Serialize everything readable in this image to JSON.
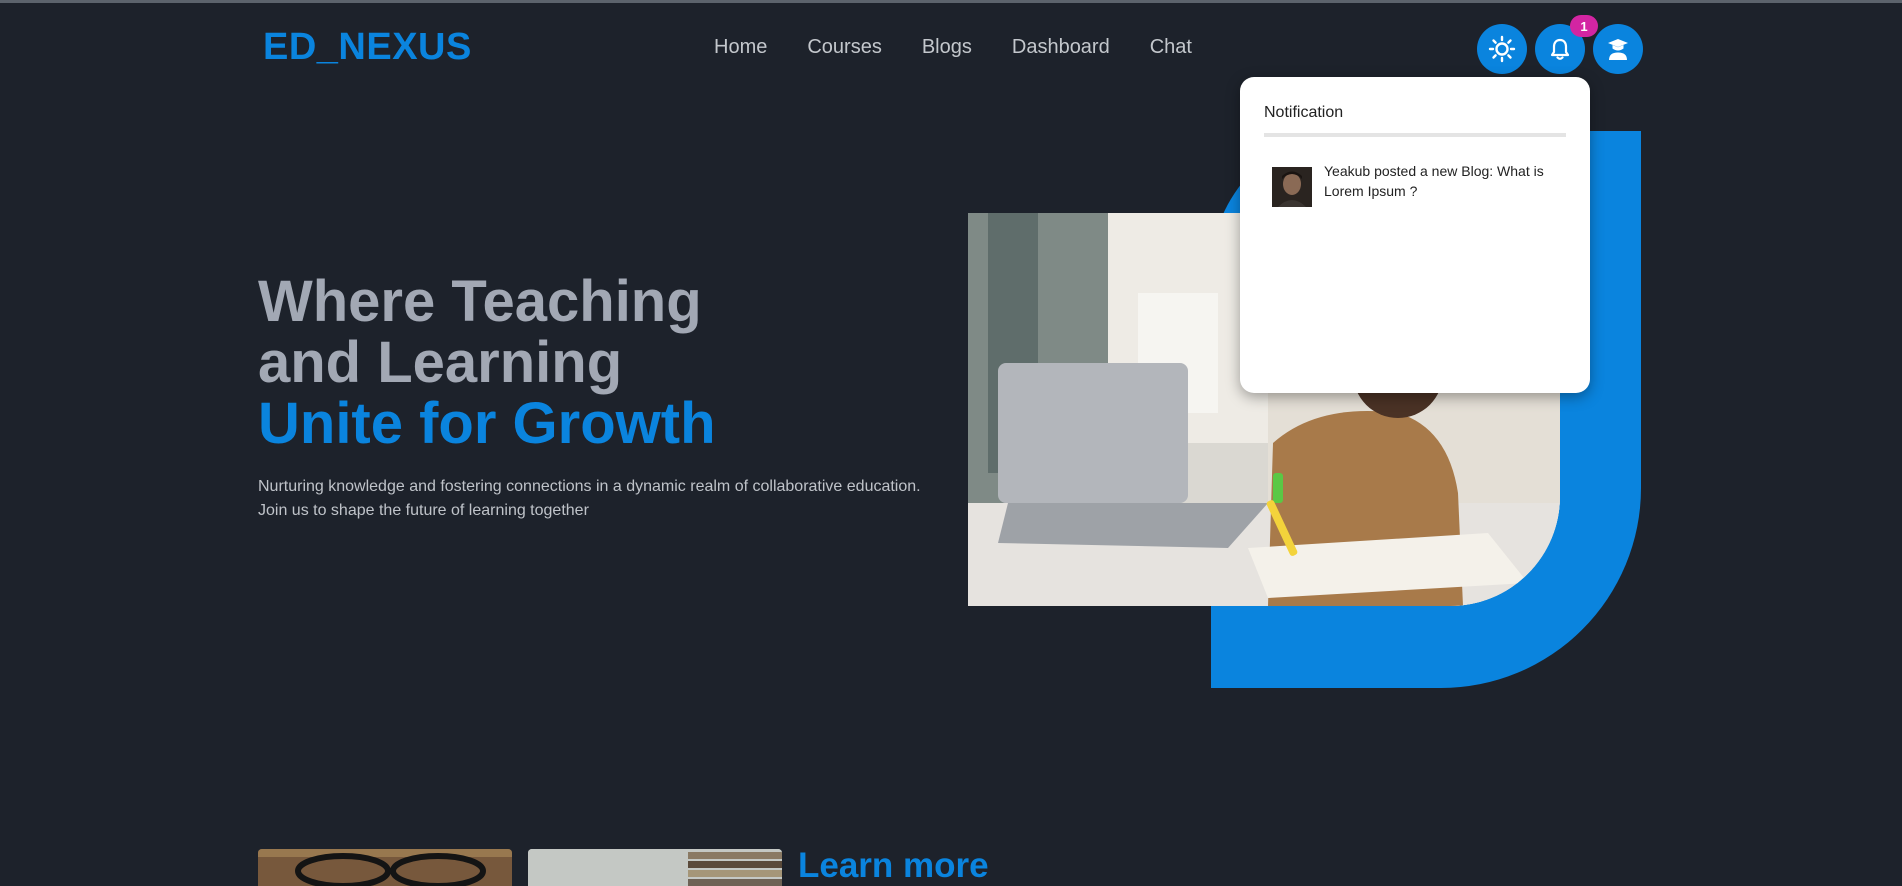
{
  "brand": {
    "logo": "ED_NEXUS"
  },
  "nav": {
    "items": [
      "Home",
      "Courses",
      "Blogs",
      "Dashboard",
      "Chat"
    ]
  },
  "header_actions": {
    "theme_icon": "sun-icon",
    "bell_icon": "bell-icon",
    "user_icon": "graduate-user-icon",
    "notification_count": "1"
  },
  "hero": {
    "line1": "Where Teaching",
    "line2": "and Learning",
    "line3": "Unite for Growth",
    "subtitle": "Nurturing knowledge and fostering connections in a dynamic realm of collaborative education. Join us to shape the future of learning together"
  },
  "notifications": {
    "title": "Notification",
    "items": [
      {
        "text": "Yeakub posted a new Blog: What is Lorem Ipsum ?"
      }
    ]
  },
  "section": {
    "learn_more": "Learn more"
  },
  "colors": {
    "accent": "#0a84de",
    "background": "#1d222b",
    "badge": "#d325a2"
  }
}
